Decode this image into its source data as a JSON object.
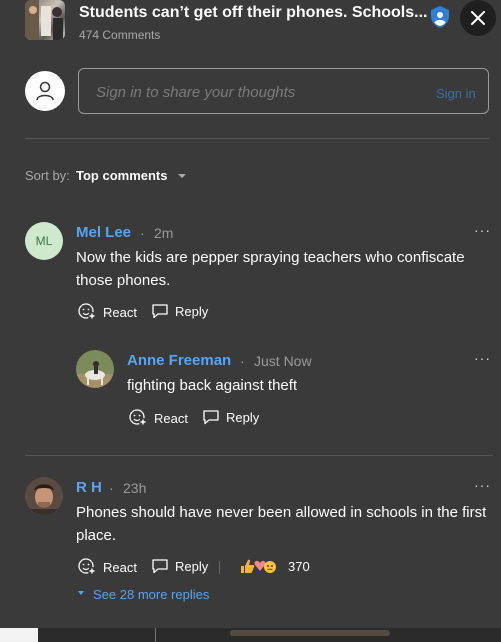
{
  "header": {
    "title": "Students can’t get off their phones. Schools...",
    "comment_count": "474 Comments"
  },
  "sign_in": {
    "placeholder": "Sign in to share your thoughts",
    "link": "Sign in"
  },
  "sort": {
    "label": "Sort by:",
    "value": "Top comments"
  },
  "comments": [
    {
      "initials": "ML",
      "name": "Mel Lee",
      "time": "2m",
      "text": "Now the kids are pepper spraying teachers who confiscate those phones.",
      "react_label": "React",
      "reply_label": "Reply",
      "replies": [
        {
          "name": "Anne Freeman",
          "time": "Just Now",
          "text": "fighting back against theft",
          "react_label": "React",
          "reply_label": "Reply"
        }
      ]
    },
    {
      "name": "R H",
      "time": "23h",
      "text": "Phones should have never been allowed in schools in the first place.",
      "react_label": "React",
      "reply_label": "Reply",
      "reaction_count": "370",
      "see_more": "See 28 more replies"
    }
  ],
  "separator_dot": "·",
  "more_glyph": "···",
  "colors": {
    "background": "#3a3a3a",
    "link_blue": "#57a3f5",
    "shield_blue": "#2f7fd6"
  },
  "icons": [
    "article-thumbnail",
    "shield-icon",
    "close-icon",
    "user-icon",
    "react-icon",
    "reply-icon",
    "caret-down-icon",
    "more-icon",
    "reaction-emojis-icon"
  ]
}
